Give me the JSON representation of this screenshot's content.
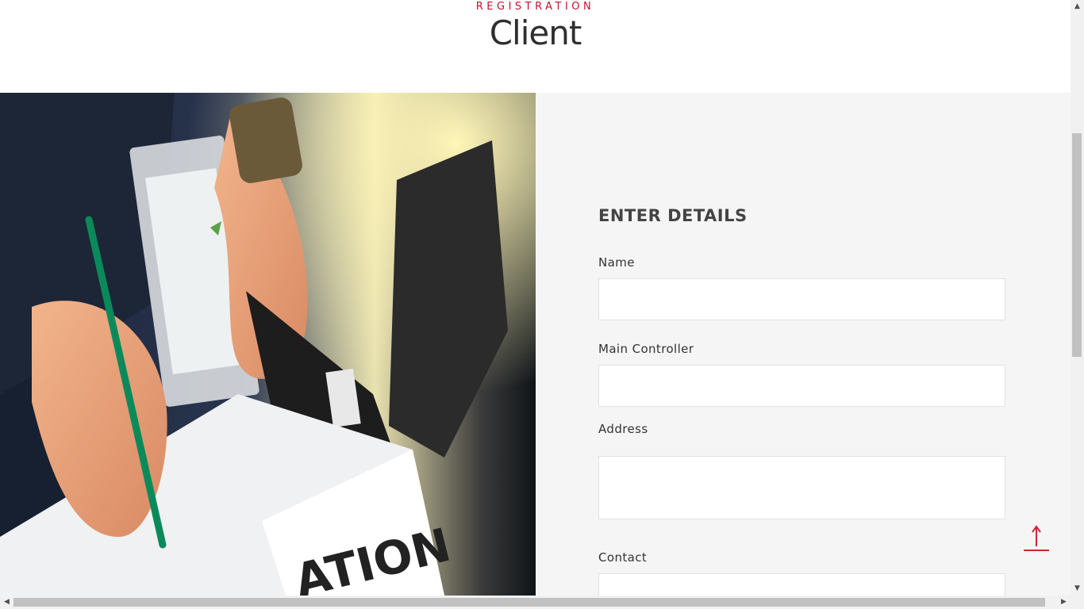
{
  "header": {
    "eyebrow": "REGISTRATION",
    "title": "Client"
  },
  "form": {
    "heading": "ENTER DETAILS",
    "fields": [
      {
        "label": "Name",
        "value": ""
      },
      {
        "label": "Main Controller",
        "value": ""
      },
      {
        "label": "Address",
        "value": ""
      },
      {
        "label": "Contact",
        "value": ""
      }
    ]
  },
  "colors": {
    "accent": "#c8102e",
    "panel_bg": "#f5f5f5",
    "heading": "#444444"
  },
  "icons": {
    "scroll_top": "arrow-up-icon"
  }
}
